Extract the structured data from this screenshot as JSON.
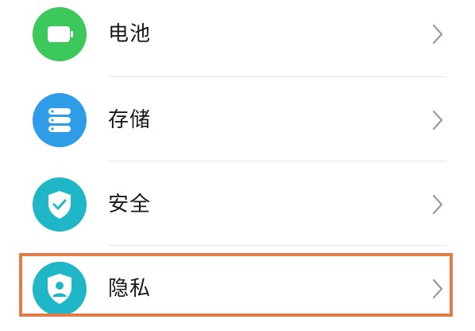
{
  "settings": {
    "items": [
      {
        "label": "电池",
        "icon": "battery-icon",
        "color": "#3cc85a"
      },
      {
        "label": "存储",
        "icon": "storage-icon",
        "color": "#2f9ce8"
      },
      {
        "label": "安全",
        "icon": "shield-check-icon",
        "color": "#1fb6c8"
      },
      {
        "label": "隐私",
        "icon": "privacy-icon",
        "color": "#1fb6c8"
      }
    ]
  },
  "highlight": {
    "color": "#e07b4a",
    "target": "隐私"
  }
}
